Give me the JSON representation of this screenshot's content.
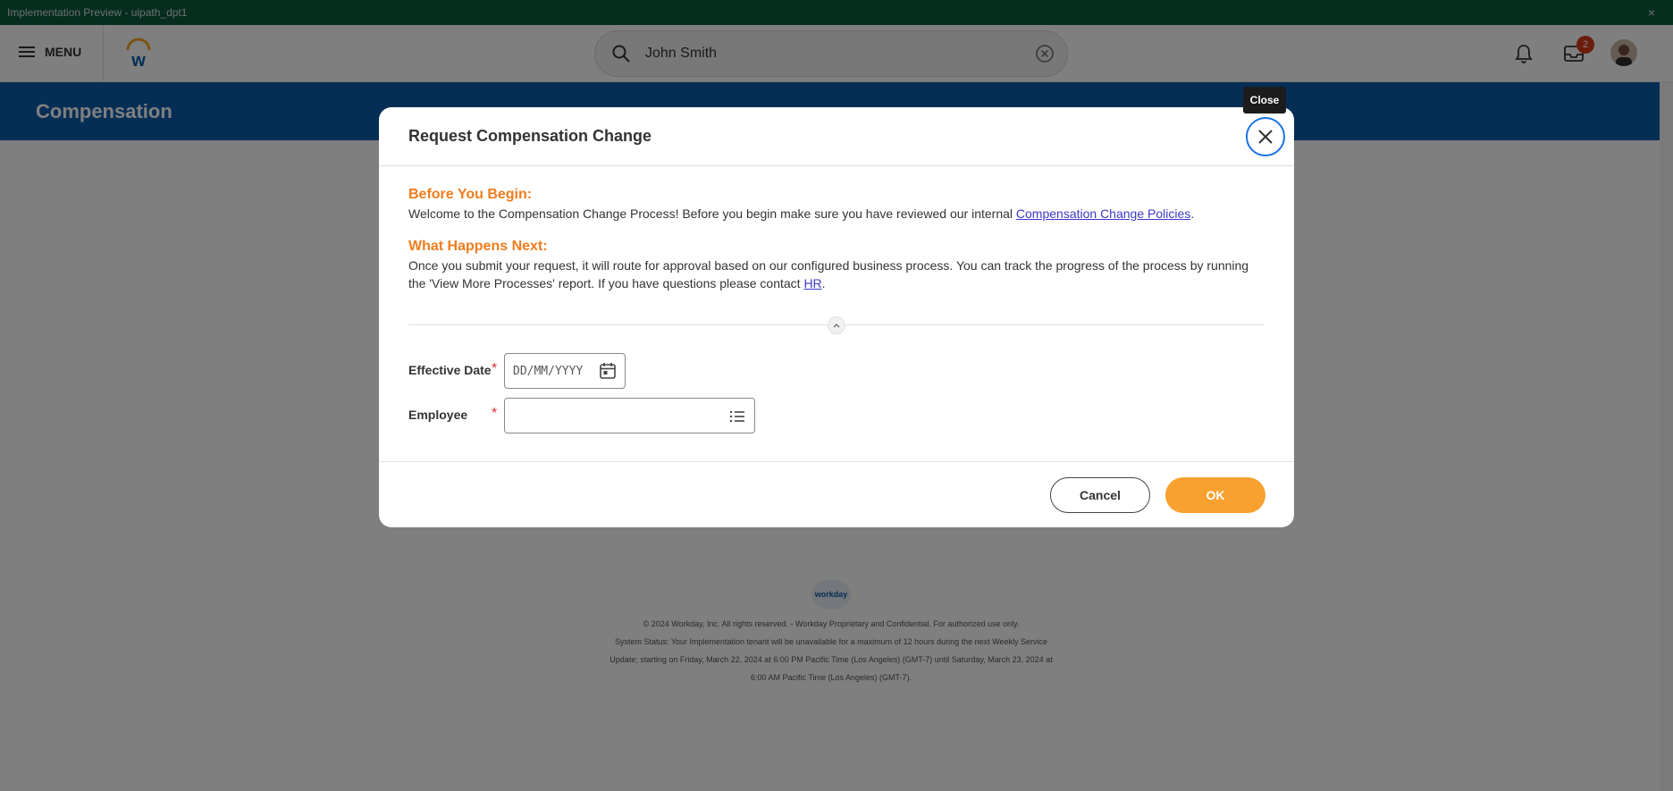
{
  "window": {
    "title": "Implementation Preview - uipath_dpt1",
    "close_glyph": "×"
  },
  "header": {
    "menu_label": "MENU",
    "search_value": "John Smith",
    "inbox_badge": "2"
  },
  "page": {
    "title": "Compensation"
  },
  "footer": {
    "logo_text": "workday",
    "lines": [
      "© 2024 Workday, Inc. All rights reserved. - Workday Proprietary and Confidential. For authorized use only.",
      "System Status: Your Implementation tenant will be unavailable for a maximum of 12 hours during the next Weekly Service",
      "Update; starting on Friday, March 22, 2024 at 6:00 PM Pacific Time (Los Angeles) (GMT-7) until Saturday, March 23, 2024 at",
      "6:00 AM Pacific Time (Los Angeles) (GMT-7)."
    ]
  },
  "modal": {
    "title": "Request Compensation Change",
    "close_tooltip": "Close",
    "before_heading": "Before You Begin:",
    "before_text_1": "Welcome to the Compensation Change Process!  Before you begin make sure you have reviewed our internal ",
    "before_link": "Compensation Change Policies",
    "before_text_2": ".",
    "next_heading": "What Happens Next:",
    "next_text_1": "Once you submit your request, it will route for approval based on our configured business process.  You can track the progress of the process by running the 'View More Processes' report.  If you have questions please contact ",
    "next_link": "HR",
    "next_text_2": ".",
    "effective_date_label": "Effective Date",
    "effective_date_placeholder": "DD/MM/YYYY",
    "employee_label": "Employee",
    "employee_value": "",
    "required_mark": "*",
    "cancel_label": "Cancel",
    "ok_label": "OK"
  },
  "colors": {
    "titlebar": "#0e5b3f",
    "banner": "#0b5cad",
    "heading_orange": "#f07c1b",
    "ok_button": "#f9a12e",
    "link": "#3a3ac8"
  }
}
